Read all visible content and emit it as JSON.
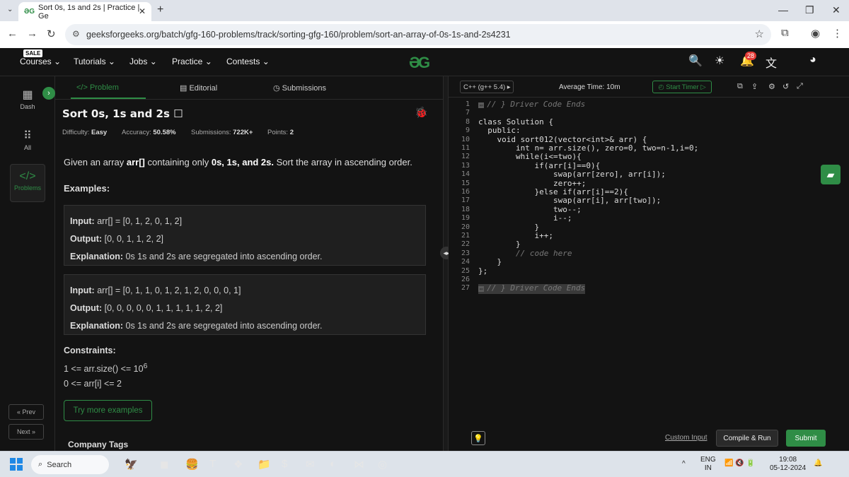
{
  "browser": {
    "tab_title": "Sort 0s, 1s and 2s | Practice | Ge",
    "url": "geeksforgeeks.org/batch/gfg-160-problems/track/sorting-gfg-160/problem/sort-an-array-of-0s-1s-and-2s4231"
  },
  "sitenav": {
    "sale": "SALE",
    "courses": "Courses",
    "tutorials": "Tutorials",
    "jobs": "Jobs",
    "practice": "Practice",
    "contests": "Contests",
    "notif_count": "28"
  },
  "sidebar": {
    "dash": "Dash",
    "all": "All",
    "problems": "Problems",
    "prev": "« Prev",
    "next": "Next »"
  },
  "problem": {
    "tab_problem": "</> Problem",
    "tab_editorial": "Editorial",
    "tab_submissions": "Submissions",
    "title": "Sort 0s, 1s and 2s",
    "difficulty_label": "Difficulty:",
    "difficulty": "Easy",
    "accuracy_label": "Accuracy:",
    "accuracy": "50.58%",
    "submissions_label": "Submissions:",
    "submissions": "722K+",
    "points_label": "Points:",
    "points": "2",
    "desc_pre": "Given an array ",
    "desc_arr": "arr[]",
    "desc_mid": " containing only ",
    "desc_vals": "0s, 1s, and 2s.",
    "desc_post": " Sort the array in ascending order.",
    "examples_head": "Examples:",
    "ex1_input": "[0, 1, 2, 0, 1, 2]",
    "ex1_output": "[0, 0, 1, 1, 2, 2]",
    "ex1_expl": "0s 1s and 2s are segregated into ascending order.",
    "ex2_input": "[0, 1, 1, 0, 1, 2, 1, 2, 0, 0, 0, 1]",
    "ex2_output": "[0, 0, 0, 0, 0, 1, 1, 1, 1, 1, 2, 2]",
    "ex2_expl": "0s 1s and 2s are segregated into ascending order.",
    "input_label": "Input:",
    "input_var": "arr[] = ",
    "output_label": "Output:",
    "expl_label": "Explanation:",
    "constraints_head": "Constraints:",
    "cons1": "1 <= arr.size() <= 10",
    "cons1_exp": "6",
    "cons2": "0 <= arr[i] <= 2",
    "try_more": "Try more examples",
    "company_tags": "Company Tags"
  },
  "editor": {
    "language": "C++ (g++ 5.4)",
    "avg_time": "Average Time: 10m",
    "start_timer": "Start Timer",
    "custom_input": "Custom Input",
    "compile_run": "Compile & Run",
    "submit": "Submit",
    "lines": [
      {
        "n": "1",
        "text": "// } Driver Code Ends",
        "type": "fold"
      },
      {
        "n": "7",
        "text": "",
        "type": "code"
      },
      {
        "n": "8",
        "text": "class Solution {",
        "type": "code"
      },
      {
        "n": "9",
        "text": "  public:",
        "type": "code"
      },
      {
        "n": "10",
        "text": "    void sort012(vector<int>& arr) {",
        "type": "code"
      },
      {
        "n": "11",
        "text": "        int n= arr.size(), zero=0, two=n-1,i=0;",
        "type": "code"
      },
      {
        "n": "12",
        "text": "        while(i<=two){",
        "type": "code"
      },
      {
        "n": "13",
        "text": "            if(arr[i]==0){",
        "type": "code"
      },
      {
        "n": "14",
        "text": "                swap(arr[zero], arr[i]);",
        "type": "code"
      },
      {
        "n": "15",
        "text": "                zero++;",
        "type": "code"
      },
      {
        "n": "16",
        "text": "            }else if(arr[i]==2){",
        "type": "code"
      },
      {
        "n": "17",
        "text": "                swap(arr[i], arr[two]);",
        "type": "code"
      },
      {
        "n": "18",
        "text": "                two--;",
        "type": "code"
      },
      {
        "n": "19",
        "text": "                i--;",
        "type": "code"
      },
      {
        "n": "20",
        "text": "            }",
        "type": "code"
      },
      {
        "n": "21",
        "text": "            i++;",
        "type": "code"
      },
      {
        "n": "22",
        "text": "        }",
        "type": "code"
      },
      {
        "n": "23",
        "text": "        // code here",
        "type": "comment"
      },
      {
        "n": "24",
        "text": "    }",
        "type": "code"
      },
      {
        "n": "25",
        "text": "};",
        "type": "code"
      },
      {
        "n": "26",
        "text": "",
        "type": "code"
      },
      {
        "n": "27",
        "text": "// } Driver Code Ends",
        "type": "fold-hl"
      }
    ]
  },
  "taskbar": {
    "search": "Search",
    "lang1": "ENG",
    "lang2": "IN",
    "time": "19:08",
    "date": "05-12-2024",
    "badge": "1"
  },
  "colors": {
    "accent": "#2f8d46",
    "background": "#131313",
    "panel": "#1f1f1f"
  }
}
